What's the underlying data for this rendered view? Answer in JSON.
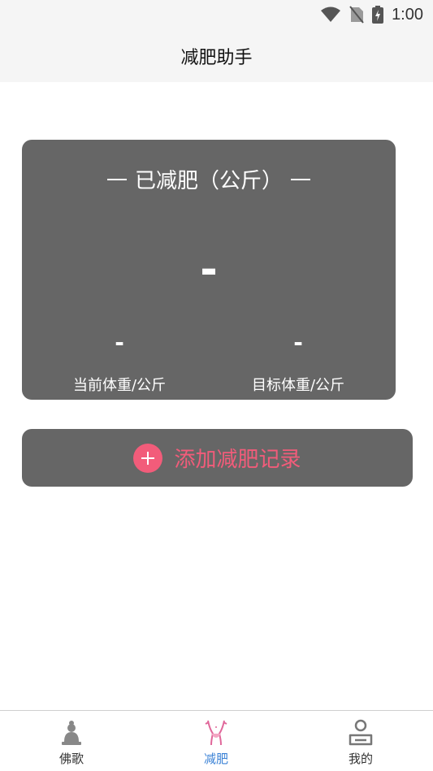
{
  "status_bar": {
    "time": "1:00"
  },
  "header": {
    "title": "减肥助手"
  },
  "summary_card": {
    "title": "已减肥（公斤）",
    "lost_value": "-",
    "current_weight": {
      "value": "-",
      "label": "当前体重/公斤"
    },
    "target_weight": {
      "value": "-",
      "label": "目标体重/公斤"
    }
  },
  "add_record": {
    "label": "添加减肥记录"
  },
  "tabs": [
    {
      "label": "佛歌",
      "icon": "buddha-icon",
      "active": false
    },
    {
      "label": "减肥",
      "icon": "slim-figure-icon",
      "active": true
    },
    {
      "label": "我的",
      "icon": "profile-icon",
      "active": false
    }
  ],
  "colors": {
    "accent": "#f25c7a",
    "active_tab": "#3b82d6",
    "card": "#666666"
  }
}
